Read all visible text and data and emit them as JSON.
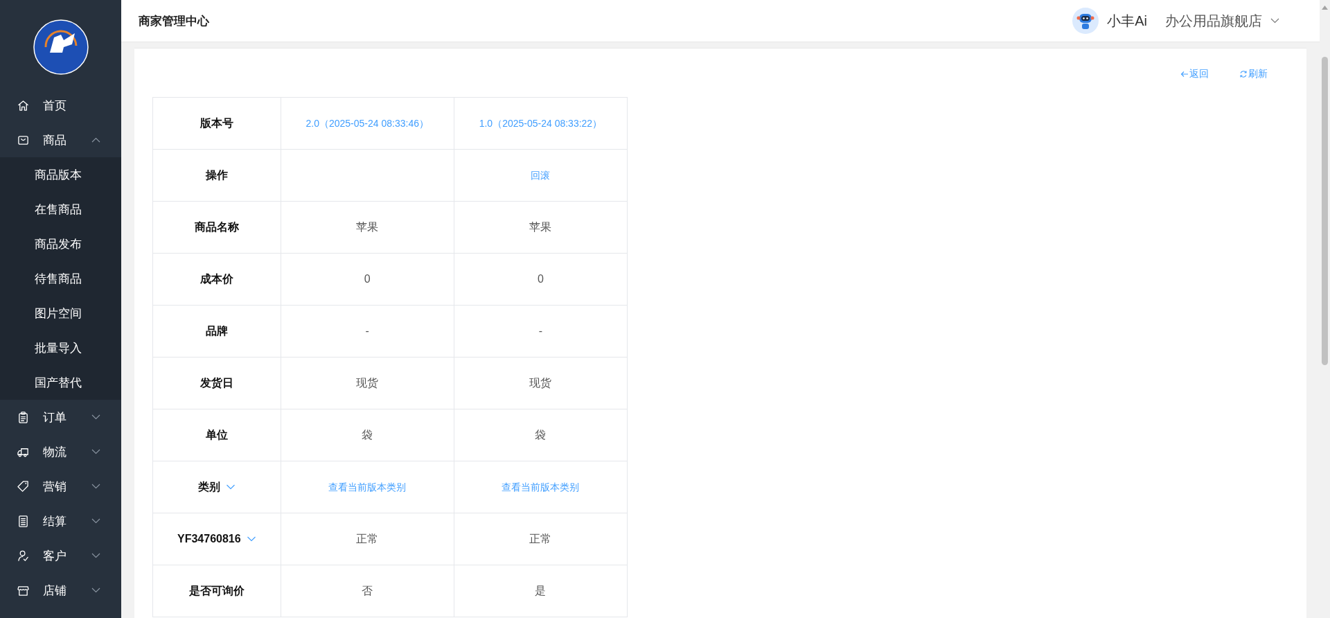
{
  "sidebar": {
    "items": [
      {
        "label": "首页",
        "kind": "home"
      },
      {
        "label": "商品",
        "kind": "bag",
        "expanded": true,
        "children": [
          {
            "label": "商品版本"
          },
          {
            "label": "在售商品"
          },
          {
            "label": "商品发布"
          },
          {
            "label": "待售商品"
          },
          {
            "label": "图片空间"
          },
          {
            "label": "批量导入"
          },
          {
            "label": "国产替代"
          }
        ]
      },
      {
        "label": "订单",
        "kind": "clipboard",
        "expanded": false
      },
      {
        "label": "物流",
        "kind": "truck",
        "expanded": false
      },
      {
        "label": "营销",
        "kind": "tag",
        "expanded": false
      },
      {
        "label": "结算",
        "kind": "receipt",
        "expanded": false
      },
      {
        "label": "客户",
        "kind": "person",
        "expanded": false
      },
      {
        "label": "店铺",
        "kind": "store",
        "expanded": false
      }
    ]
  },
  "header": {
    "title": "商家管理中心",
    "assistant": "小丰Ai",
    "shop": "办公用品旗舰店"
  },
  "toolbar": {
    "back": "返回",
    "refresh": "刷新"
  },
  "table": {
    "rows": [
      {
        "label": "版本号",
        "collapsible": false,
        "cells": [
          {
            "kind": "link",
            "text": "2.0（2025-05-24 08:33:46）"
          },
          {
            "kind": "link",
            "text": "1.0（2025-05-24 08:33:22）"
          }
        ]
      },
      {
        "label": "操作",
        "collapsible": false,
        "cells": [
          {
            "kind": "blank"
          },
          {
            "kind": "link",
            "text": "回滚"
          }
        ]
      },
      {
        "label": "商品名称",
        "collapsible": false,
        "cells": [
          {
            "kind": "text",
            "text": "苹果"
          },
          {
            "kind": "text",
            "text": "苹果"
          }
        ]
      },
      {
        "label": "成本价",
        "collapsible": false,
        "cells": [
          {
            "kind": "text",
            "text": "0"
          },
          {
            "kind": "text",
            "text": "0"
          }
        ]
      },
      {
        "label": "品牌",
        "collapsible": false,
        "cells": [
          {
            "kind": "text",
            "text": "-"
          },
          {
            "kind": "text",
            "text": "-"
          }
        ]
      },
      {
        "label": "发货日",
        "collapsible": false,
        "cells": [
          {
            "kind": "text",
            "text": "现货"
          },
          {
            "kind": "text",
            "text": "现货"
          }
        ]
      },
      {
        "label": "单位",
        "collapsible": false,
        "cells": [
          {
            "kind": "text",
            "text": "袋"
          },
          {
            "kind": "text",
            "text": "袋"
          }
        ]
      },
      {
        "label": "类别",
        "collapsible": true,
        "cells": [
          {
            "kind": "link",
            "text": "查看当前版本类别"
          },
          {
            "kind": "link",
            "text": "查看当前版本类别"
          }
        ]
      },
      {
        "label": "YF34760816",
        "collapsible": true,
        "cells": [
          {
            "kind": "text",
            "text": "正常"
          },
          {
            "kind": "text",
            "text": "正常"
          }
        ]
      },
      {
        "label": "是否可询价",
        "collapsible": false,
        "cells": [
          {
            "kind": "text",
            "text": "否"
          },
          {
            "kind": "text",
            "text": "是"
          }
        ]
      }
    ]
  }
}
